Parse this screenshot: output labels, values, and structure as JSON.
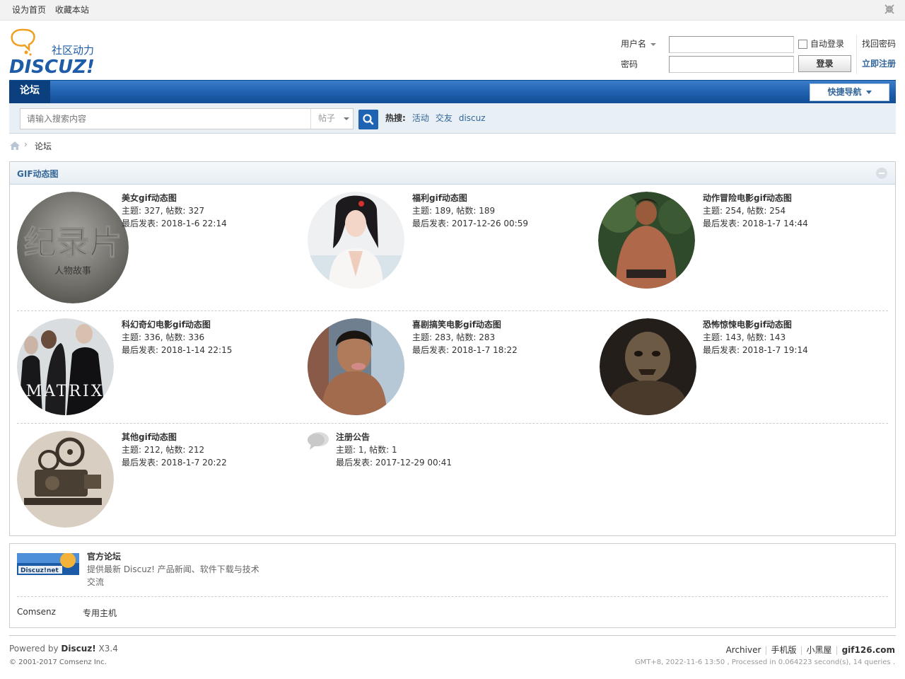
{
  "topbar": {
    "set_home": "设为首页",
    "bookmark": "收藏本站"
  },
  "logo": {
    "tagline": "社区动力",
    "brand": "DISCUZ!"
  },
  "login": {
    "username_label": "用户名",
    "password_label": "密码",
    "auto_login": "自动登录",
    "login_button": "登录",
    "forgot_password": "找回密码",
    "register": "立即注册"
  },
  "nav": {
    "current": "论坛",
    "quick_nav": "快捷导航"
  },
  "search": {
    "placeholder": "请输入搜索内容",
    "type": "帖子",
    "hot_label": "热搜:",
    "hot_keywords": [
      "活动",
      "交友",
      "discuz"
    ]
  },
  "breadcrumb": {
    "current": "论坛"
  },
  "category": {
    "title": "GIF动态图",
    "forums": [
      {
        "name": "美女gif动态图",
        "stats": "主题: 327, 帖数: 327",
        "last": "最后发表: 2018-1-6 22:14",
        "thumb_text": "纪录片",
        "thumb_sub": "人物故事"
      },
      {
        "name": "福利gif动态图",
        "stats": "主题: 189, 帖数: 189",
        "last": "最后发表: 2017-12-26 00:59"
      },
      {
        "name": "动作冒险电影gif动态图",
        "stats": "主题: 254, 帖数: 254",
        "last": "最后发表: 2018-1-7 14:44"
      },
      {
        "name": "科幻奇幻电影gif动态图",
        "stats": "主题: 336, 帖数: 336",
        "last": "最后发表: 2018-1-14 22:15",
        "thumb_text": "MATRIX"
      },
      {
        "name": "喜剧搞笑电影gif动态图",
        "stats": "主题: 283, 帖数: 283",
        "last": "最后发表: 2018-1-7 18:22"
      },
      {
        "name": "恐怖惊悚电影gif动态图",
        "stats": "主题: 143, 帖数: 143",
        "last": "最后发表: 2018-1-7 19:14"
      },
      {
        "name": "其他gif动态图",
        "stats": "主题: 212, 帖数: 212",
        "last": "最后发表: 2018-1-7 20:22"
      },
      {
        "name": "注册公告",
        "stats": "主题: 1, 帖数: 1",
        "last": "最后发表: 2017-12-29 00:41"
      }
    ]
  },
  "links": {
    "logo_text": "Discuz!net",
    "name": "官方论坛",
    "desc": "提供最新 Discuz! 产品新闻、软件下载与技术交流",
    "text_links": [
      "Comsenz",
      "专用主机"
    ]
  },
  "footer": {
    "powered_prefix": "Powered by ",
    "powered_brand": "Discuz!",
    "version": " X3.4",
    "copyright_prefix": "© 2001-2017 ",
    "copyright_company": "Comsenz Inc.",
    "links": [
      "Archiver",
      "手机版",
      "小黑屋"
    ],
    "site": "gif126.com",
    "processed": "GMT+8, 2022-11-6 13:50 , Processed in 0.064223 second(s), 14 queries ."
  },
  "colors": {
    "brand_blue": "#1f5fad",
    "link_blue": "#336699",
    "nav_current": "#0b3f7e"
  }
}
